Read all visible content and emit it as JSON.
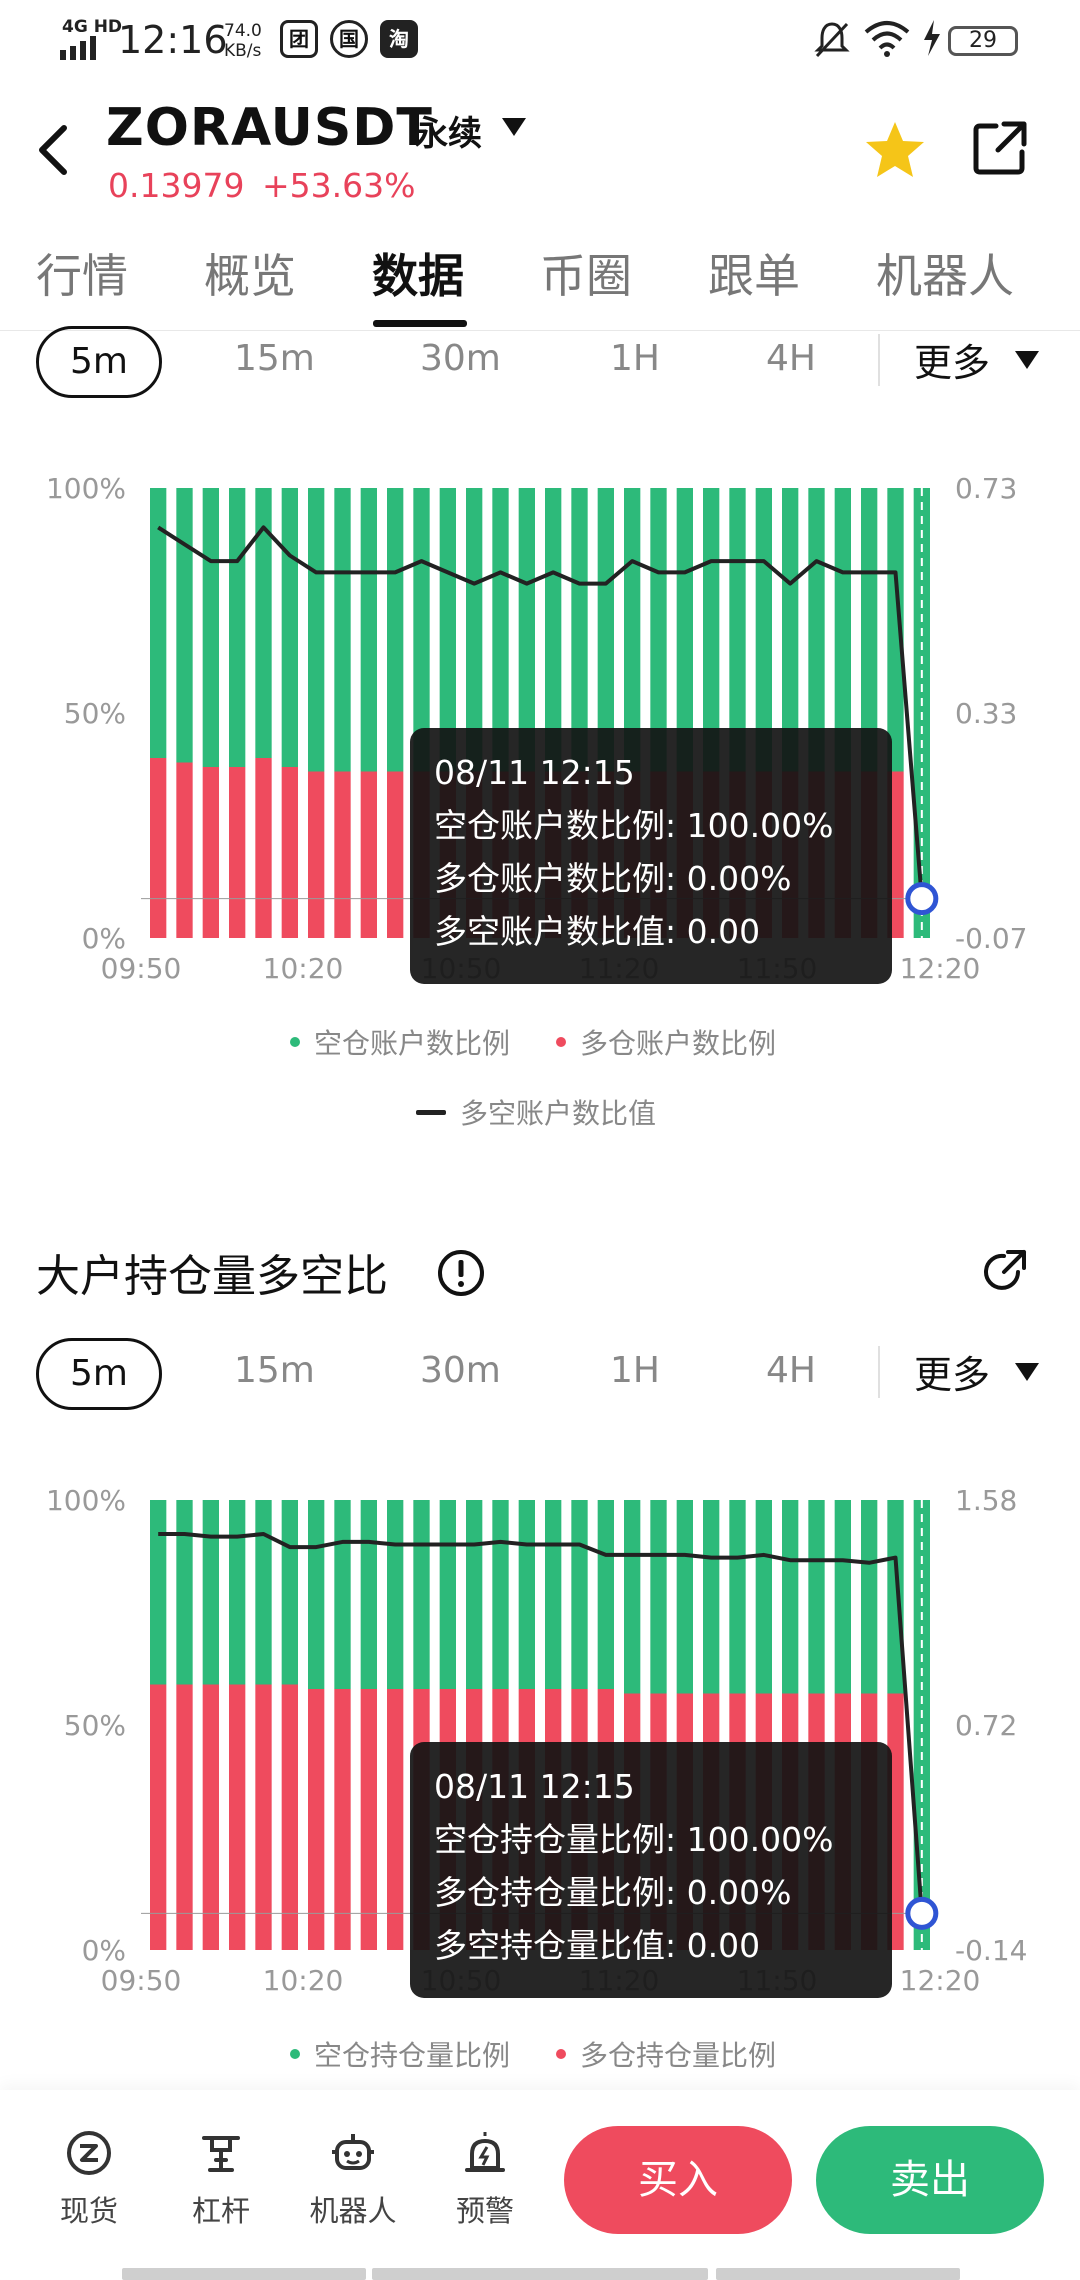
{
  "status_bar": {
    "network": "4G HD",
    "time": "12:16",
    "speed_value": "74.0",
    "speed_unit": "KB/s",
    "app_icons": [
      "团",
      "国",
      "淘"
    ],
    "battery": "29"
  },
  "header": {
    "symbol": "ZORAUSDT",
    "contract_type": "永续",
    "price": "0.13979",
    "change": "+53.63%"
  },
  "tabs": [
    {
      "label": "行情",
      "active": false
    },
    {
      "label": "概览",
      "active": false
    },
    {
      "label": "数据",
      "active": true
    },
    {
      "label": "币圈",
      "active": false
    },
    {
      "label": "跟单",
      "active": false
    },
    {
      "label": "机器人",
      "active": false
    }
  ],
  "intervals": [
    "5m",
    "15m",
    "30m",
    "1H",
    "4H"
  ],
  "interval_more": "更多",
  "colors": {
    "green": "#2dba7a",
    "red": "#ef4b5e",
    "line": "#222222",
    "marker": "#2f55d4"
  },
  "chart1": {
    "left_axis": [
      "100%",
      "50%",
      "0%"
    ],
    "right_axis": [
      "0.73",
      "0.33",
      "-0.07"
    ],
    "x_ticks": [
      "09:50",
      "10:20",
      "10:50",
      "11:20",
      "11:50",
      "12:20"
    ],
    "legend": [
      "空仓账户数比例",
      "多仓账户数比例",
      "多空账户数比值"
    ],
    "tooltip": {
      "time": "08/11 12:15",
      "row1": "空仓账户数比例: 100.00%",
      "row2": "多仓账户数比例: 0.00%",
      "row3": "多空账户数比值: 0.00"
    }
  },
  "section2": {
    "title": "大户持仓量多空比"
  },
  "chart2": {
    "left_axis": [
      "100%",
      "50%",
      "0%"
    ],
    "right_axis": [
      "1.58",
      "0.72",
      "-0.14"
    ],
    "x_ticks": [
      "09:50",
      "10:20",
      "10:50",
      "11:20",
      "11:50",
      "12:20"
    ],
    "legend": [
      "空仓持仓量比例",
      "多仓持仓量比例"
    ],
    "tooltip": {
      "time": "08/11 12:15",
      "row1": "空仓持仓量比例: 100.00%",
      "row2": "多仓持仓量比例: 0.00%",
      "row3": "多空持仓量比值: 0.00"
    }
  },
  "chart_data": [
    {
      "type": "bar",
      "x": [
        "09:50",
        "09:55",
        "10:00",
        "10:05",
        "10:10",
        "10:15",
        "10:20",
        "10:25",
        "10:30",
        "10:35",
        "10:40",
        "10:45",
        "10:50",
        "10:55",
        "11:00",
        "11:05",
        "11:10",
        "11:15",
        "11:20",
        "11:25",
        "11:30",
        "11:35",
        "11:40",
        "11:45",
        "11:50",
        "11:55",
        "12:00",
        "12:05",
        "12:10",
        "12:15"
      ],
      "series": [
        {
          "name": "多仓账户数比例",
          "values": [
            40,
            39,
            38,
            38,
            40,
            38,
            37,
            37,
            37,
            37,
            37,
            37,
            37,
            37,
            37,
            37,
            37,
            37,
            37,
            37,
            37,
            37,
            37,
            37,
            37,
            37,
            37,
            37,
            37,
            0
          ]
        },
        {
          "name": "空仓账户数比例",
          "values": [
            60,
            61,
            62,
            62,
            60,
            62,
            63,
            63,
            63,
            63,
            63,
            63,
            63,
            63,
            63,
            63,
            63,
            63,
            63,
            63,
            63,
            63,
            63,
            63,
            63,
            63,
            63,
            63,
            63,
            100
          ]
        },
        {
          "name": "多空账户数比值",
          "values": [
            0.66,
            0.63,
            0.6,
            0.6,
            0.66,
            0.61,
            0.58,
            0.58,
            0.58,
            0.58,
            0.6,
            0.58,
            0.56,
            0.58,
            0.56,
            0.58,
            0.56,
            0.56,
            0.6,
            0.58,
            0.58,
            0.6,
            0.6,
            0.6,
            0.56,
            0.6,
            0.58,
            0.58,
            0.58,
            0.0
          ]
        }
      ],
      "ylim": [
        0,
        100
      ],
      "y2lim": [
        -0.07,
        0.73
      ]
    },
    {
      "type": "bar",
      "x": [
        "09:50",
        "09:55",
        "10:00",
        "10:05",
        "10:10",
        "10:15",
        "10:20",
        "10:25",
        "10:30",
        "10:35",
        "10:40",
        "10:45",
        "10:50",
        "10:55",
        "11:00",
        "11:05",
        "11:10",
        "11:15",
        "11:20",
        "11:25",
        "11:30",
        "11:35",
        "11:40",
        "11:45",
        "11:50",
        "11:55",
        "12:00",
        "12:05",
        "12:10",
        "12:15"
      ],
      "series": [
        {
          "name": "多仓持仓量比例",
          "values": [
            59,
            59,
            59,
            59,
            59,
            59,
            58,
            58,
            58,
            58,
            58,
            58,
            58,
            58,
            58,
            58,
            58,
            58,
            57,
            57,
            57,
            57,
            57,
            57,
            57,
            57,
            57,
            57,
            57,
            0
          ]
        },
        {
          "name": "空仓持仓量比例",
          "values": [
            41,
            41,
            41,
            41,
            41,
            41,
            42,
            42,
            42,
            42,
            42,
            42,
            42,
            42,
            42,
            42,
            42,
            42,
            43,
            43,
            43,
            43,
            43,
            43,
            43,
            43,
            43,
            43,
            43,
            100
          ]
        },
        {
          "name": "多空持仓量比值",
          "values": [
            1.45,
            1.45,
            1.44,
            1.44,
            1.45,
            1.4,
            1.4,
            1.42,
            1.42,
            1.41,
            1.41,
            1.41,
            1.41,
            1.42,
            1.41,
            1.41,
            1.41,
            1.37,
            1.37,
            1.37,
            1.37,
            1.36,
            1.36,
            1.37,
            1.35,
            1.35,
            1.35,
            1.34,
            1.36,
            0.0
          ]
        }
      ],
      "ylim": [
        0,
        100
      ],
      "y2lim": [
        -0.14,
        1.58
      ]
    }
  ],
  "bottom_nav": [
    {
      "label": "现货",
      "icon": "spot-icon"
    },
    {
      "label": "杠杆",
      "icon": "leverage-icon"
    },
    {
      "label": "机器人",
      "icon": "robot-icon"
    },
    {
      "label": "预警",
      "icon": "alert-icon"
    }
  ],
  "actions": {
    "buy": "买入",
    "sell": "卖出"
  }
}
